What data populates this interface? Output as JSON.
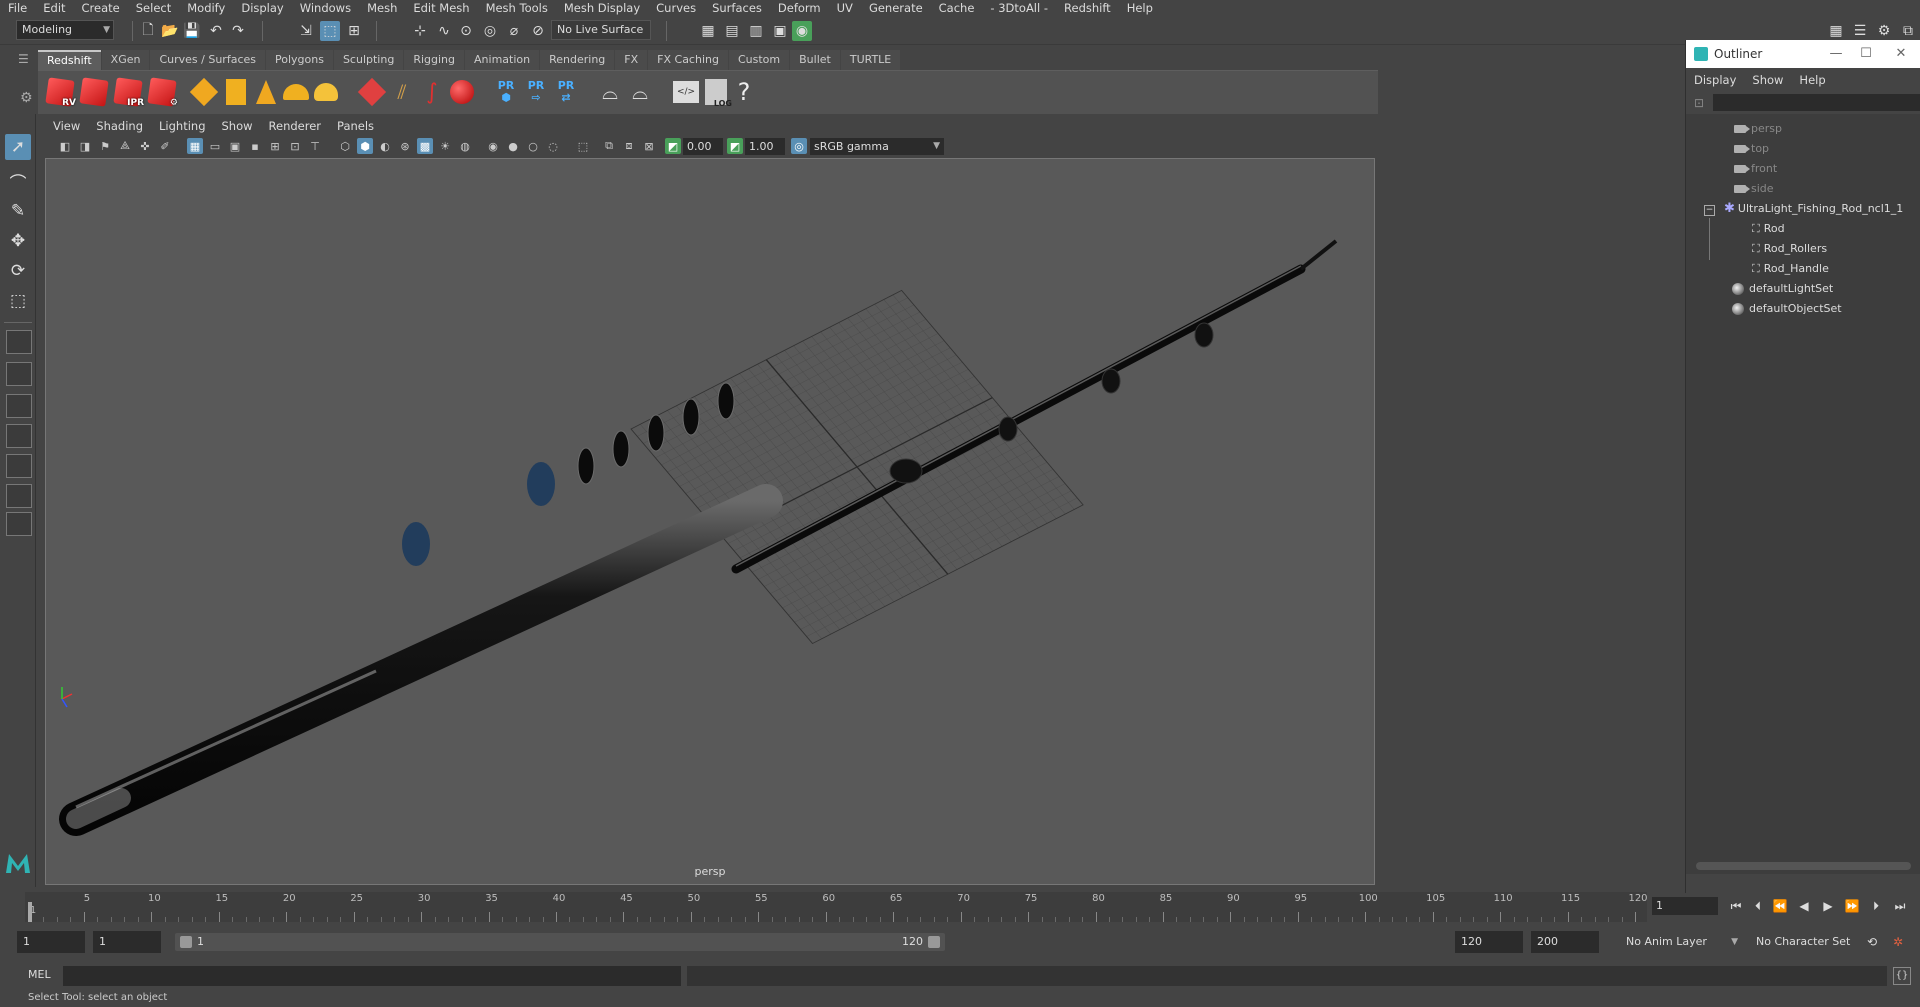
{
  "menubar": {
    "items": [
      "File",
      "Edit",
      "Create",
      "Select",
      "Modify",
      "Display",
      "Windows",
      "Mesh",
      "Edit Mesh",
      "Mesh Tools",
      "Mesh Display",
      "Curves",
      "Surfaces",
      "Deform",
      "UV",
      "Generate",
      "Cache",
      "- 3DtoAll -",
      "Redshift",
      "Help"
    ]
  },
  "statusline": {
    "menuset": "Modeling",
    "live_surface": "No Live Surface"
  },
  "shelf": {
    "tabs": [
      "Redshift",
      "XGen",
      "Curves / Surfaces",
      "Polygons",
      "Sculpting",
      "Rigging",
      "Animation",
      "Rendering",
      "FX",
      "FX Caching",
      "Custom",
      "Bullet",
      "TURTLE"
    ],
    "active_tab": "Redshift",
    "icon_labels": {
      "rv": "RV",
      "ipr": "IPR",
      "pr": "PR",
      "log": "LOG"
    }
  },
  "viewport": {
    "menu": [
      "View",
      "Shading",
      "Lighting",
      "Show",
      "Renderer",
      "Panels"
    ],
    "exposure": "0.00",
    "gamma": "1.00",
    "color_space": "sRGB gamma",
    "camera_label": "persp"
  },
  "outliner": {
    "title": "Outliner",
    "menu": [
      "Display",
      "Show",
      "Help"
    ],
    "items": [
      {
        "label": "persp",
        "type": "camera"
      },
      {
        "label": "top",
        "type": "camera"
      },
      {
        "label": "front",
        "type": "camera"
      },
      {
        "label": "side",
        "type": "camera"
      },
      {
        "label": "UltraLight_Fishing_Rod_ncl1_1",
        "type": "group"
      },
      {
        "label": "Rod",
        "type": "mesh"
      },
      {
        "label": "Rod_Rollers",
        "type": "mesh"
      },
      {
        "label": "Rod_Handle",
        "type": "mesh"
      },
      {
        "label": "defaultLightSet",
        "type": "set"
      },
      {
        "label": "defaultObjectSet",
        "type": "set"
      }
    ]
  },
  "timeline": {
    "ticks": [
      "1",
      "5",
      "10",
      "15",
      "20",
      "25",
      "30",
      "35",
      "40",
      "45",
      "50",
      "55",
      "60",
      "65",
      "70",
      "75",
      "80",
      "85",
      "90",
      "95",
      "100",
      "105",
      "110",
      "115",
      "120"
    ],
    "current_frame": "1"
  },
  "range": {
    "start": "1",
    "playback_start": "1",
    "slider_start": "1",
    "slider_end": "120",
    "playback_end": "120",
    "end": "200",
    "anim_layer": "No Anim Layer",
    "character_set": "No Character Set"
  },
  "commandline": {
    "lang": "MEL",
    "help": "Select Tool: select an object"
  }
}
